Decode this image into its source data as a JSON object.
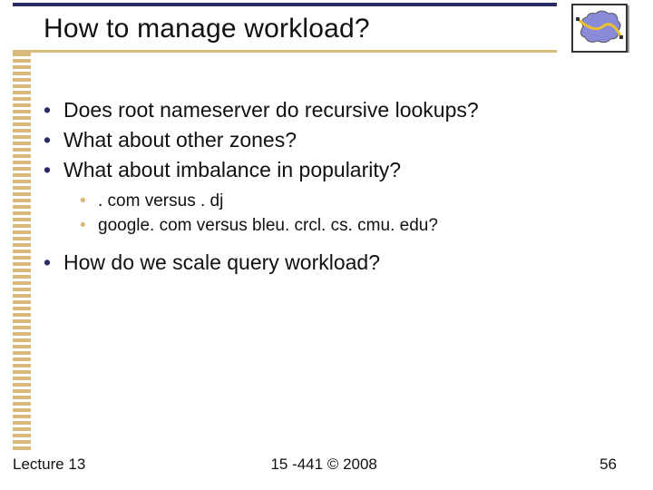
{
  "title": "How to manage workload?",
  "bullets": {
    "b1": "Does root nameserver do recursive lookups?",
    "b2": "What about other zones?",
    "b3": "What about imbalance in popularity?",
    "b3_sub": {
      "s1": ". com versus . dj",
      "s2": "google. com versus bleu. crcl. cs. cmu. edu?"
    },
    "b4": "How do we scale query workload?"
  },
  "footer": {
    "left": "Lecture 13",
    "center": "15 -441 ©  2008",
    "right": "56"
  },
  "theme": {
    "accent_dark": "#2a2a6a",
    "accent_tan": "#d9b97a"
  }
}
